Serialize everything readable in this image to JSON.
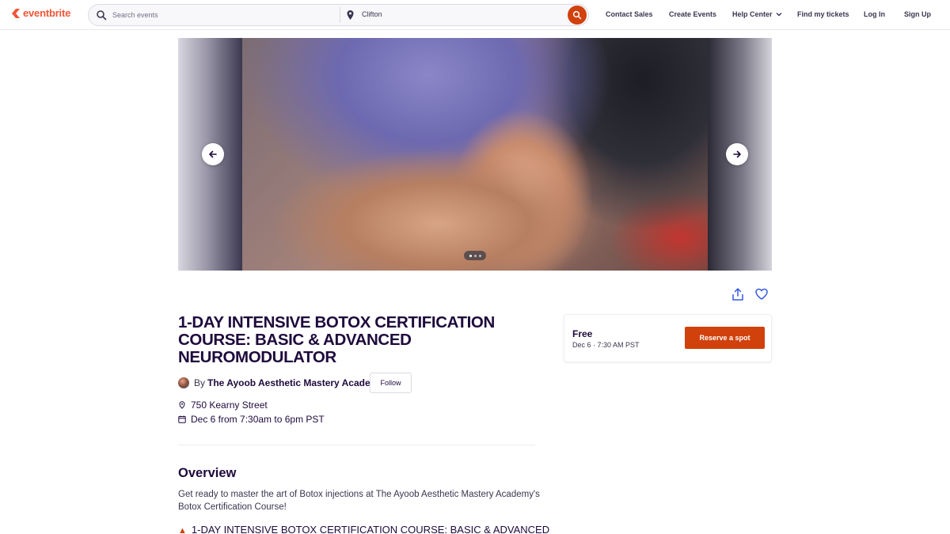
{
  "header": {
    "logo_text": "eventbrite",
    "search": {
      "placeholder": "Search events",
      "location": "Clifton"
    },
    "nav": {
      "contact_sales": "Contact Sales",
      "create_events": "Create Events",
      "help_center": "Help Center",
      "find_tickets": "Find my tickets",
      "log_in": "Log In",
      "sign_up": "Sign Up"
    }
  },
  "hero": {
    "slide_count": 3,
    "active_slide": 0
  },
  "event": {
    "title": "1-DAY INTENSIVE BOTOX CERTIFICATION COURSE: BASIC & ADVANCED NEUROMODULATOR",
    "by_label": "By",
    "organizer": "The Ayoob Aesthetic Mastery Academy",
    "follow_label": "Follow",
    "location": "750 Kearny Street",
    "datetime": "Dec 6 from 7:30am to 6pm PST"
  },
  "ticket": {
    "price": "Free",
    "date": "Dec 6 · 7:30 AM PST",
    "reserve_label": "Reserve a spot"
  },
  "overview": {
    "heading": "Overview",
    "paragraph": "Get ready to master the art of Botox injections at The Ayoob Aesthetic Mastery Academy's Botox Certification Course!",
    "cutoff_line": "1-DAY INTENSIVE BOTOX CERTIFICATION COURSE: BASIC & ADVANCED"
  },
  "colors": {
    "brand": "#f05537",
    "accent": "#d1410c",
    "text_dark": "#1e0a3c"
  }
}
